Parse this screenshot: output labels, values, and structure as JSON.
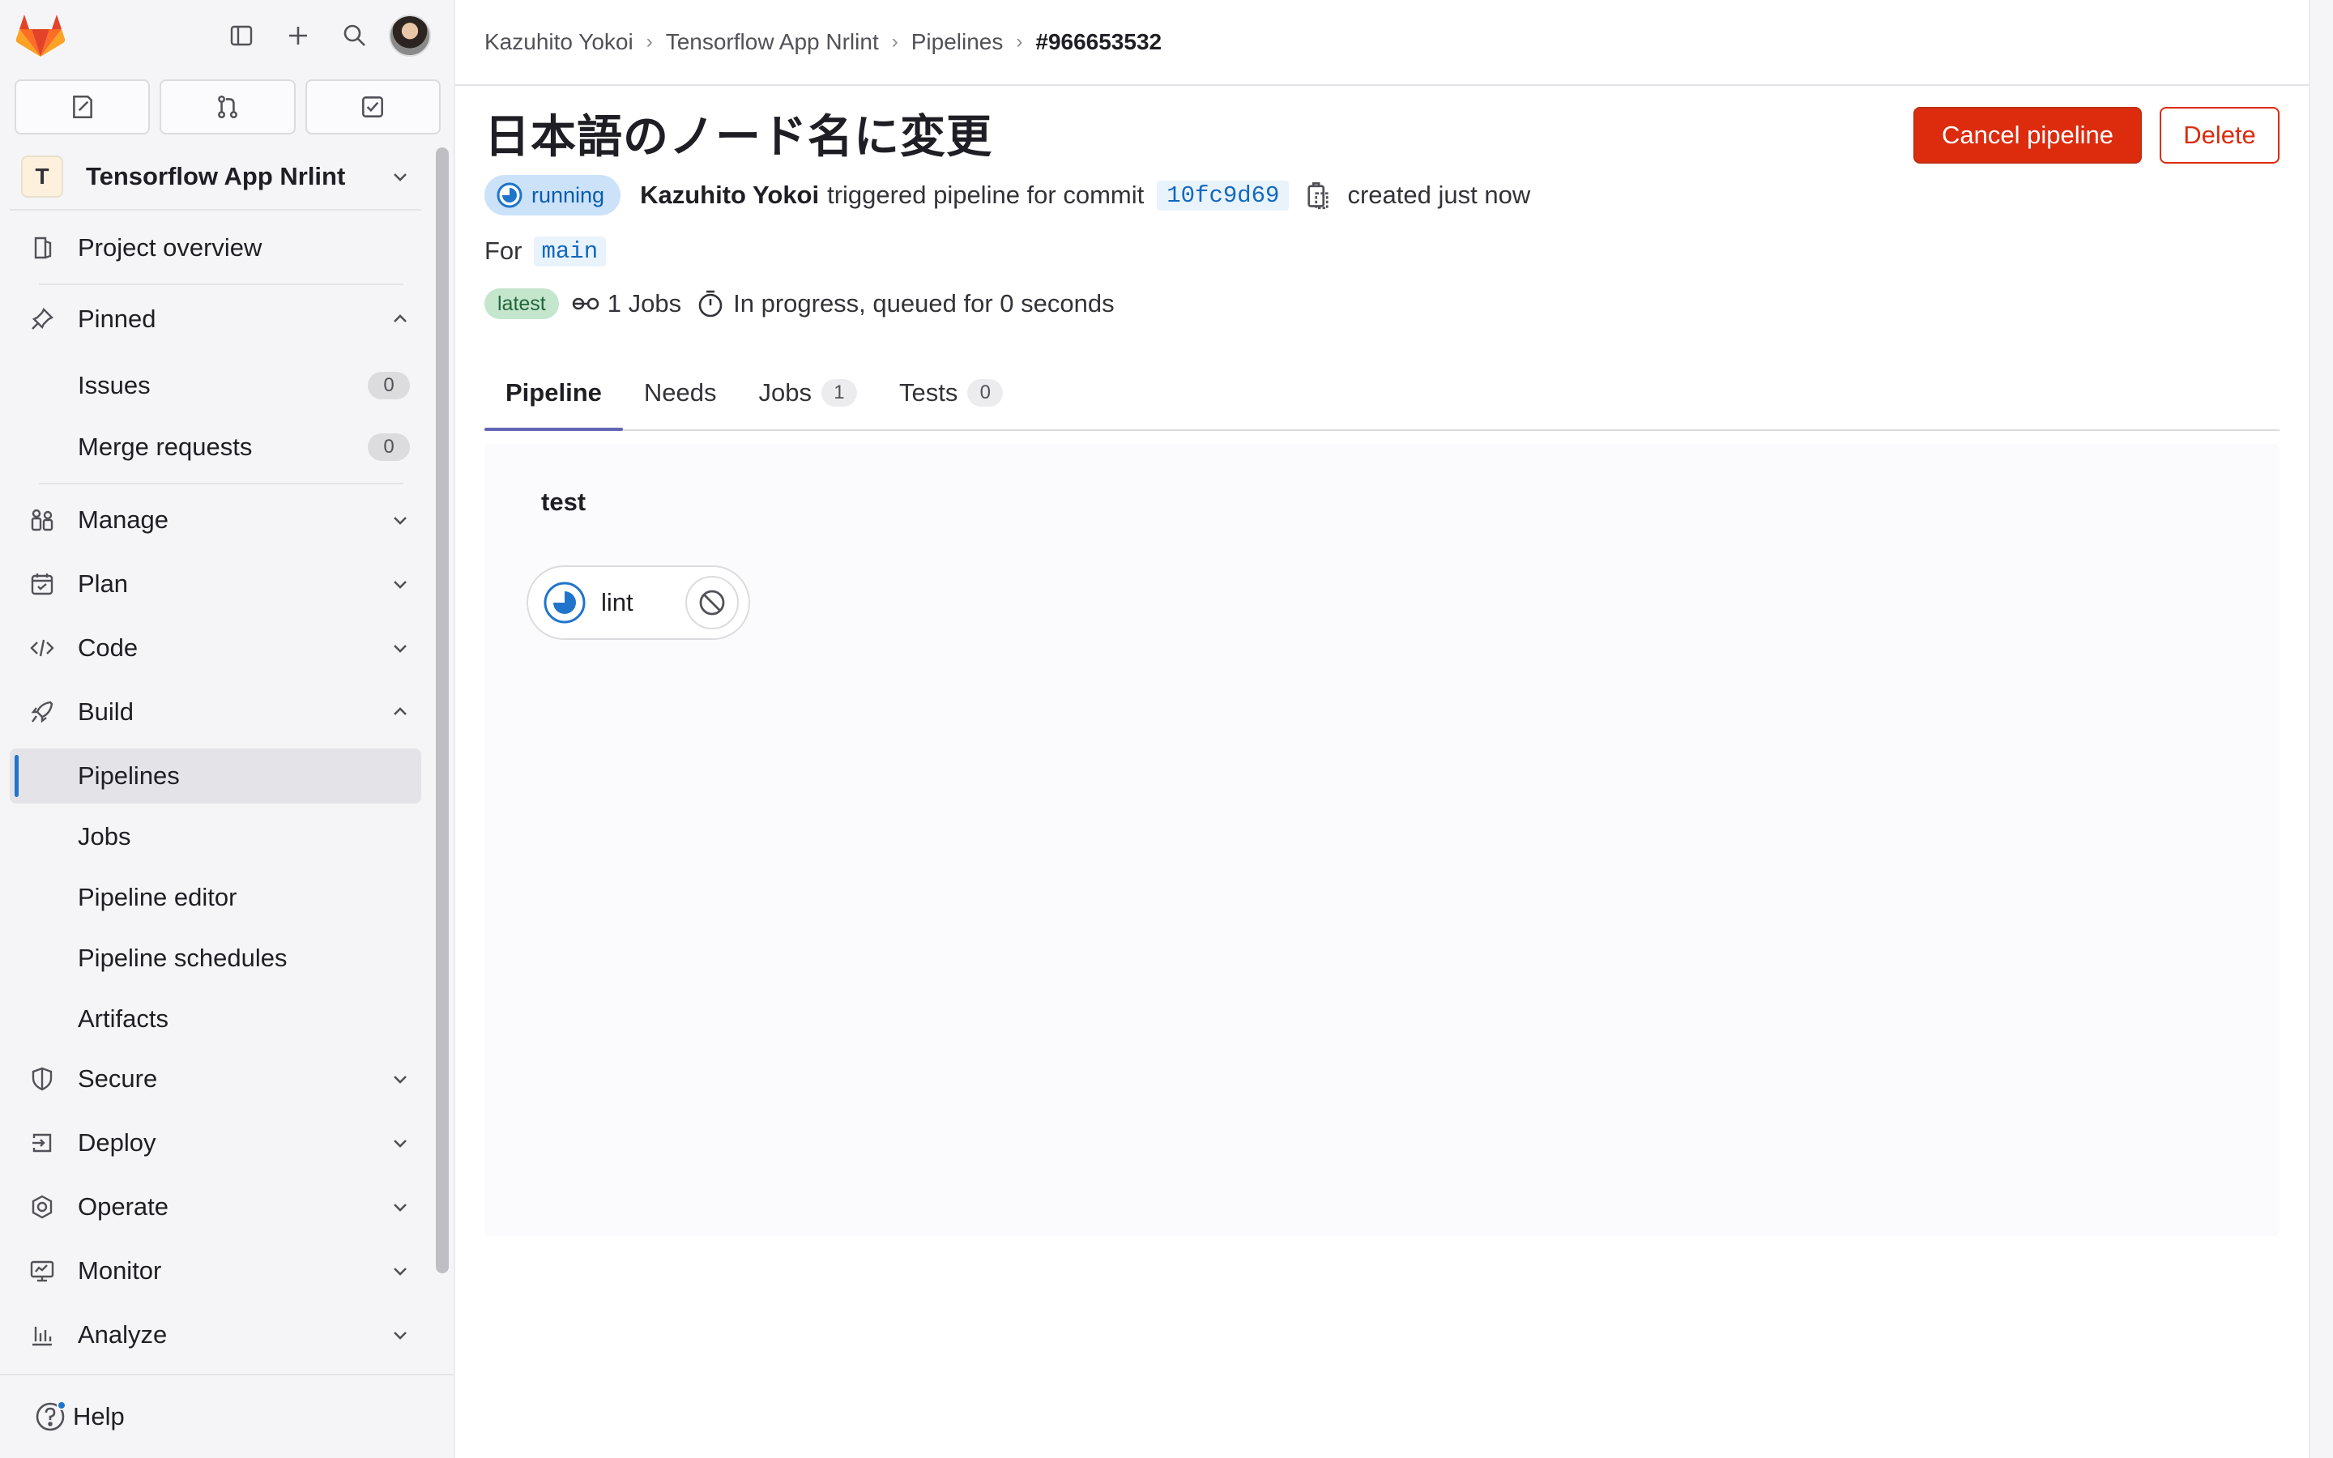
{
  "sidebar": {
    "project": {
      "avatar_letter": "T",
      "name": "Tensorflow App Nrlint"
    },
    "project_overview": "Project overview",
    "pinned": {
      "label": "Pinned",
      "items": [
        {
          "label": "Issues",
          "count": "0"
        },
        {
          "label": "Merge requests",
          "count": "0"
        }
      ]
    },
    "sections": {
      "manage": "Manage",
      "plan": "Plan",
      "code": "Code",
      "build": "Build",
      "secure": "Secure",
      "deploy": "Deploy",
      "operate": "Operate",
      "monitor": "Monitor",
      "analyze": "Analyze"
    },
    "build_items": [
      "Pipelines",
      "Jobs",
      "Pipeline editor",
      "Pipeline schedules",
      "Artifacts"
    ],
    "help": "Help"
  },
  "breadcrumb": {
    "items": [
      "Kazuhito Yokoi",
      "Tensorflow App Nrlint",
      "Pipelines"
    ],
    "current": "#966653532",
    "separator": "›"
  },
  "pipeline": {
    "title": "日本語のノード名に変更",
    "status": "running",
    "user": "Kazuhito Yokoi",
    "triggered_text": "triggered pipeline for commit",
    "commit_sha": "10fc9d69",
    "created_text": "created just now",
    "for_label": "For",
    "ref": "main",
    "latest_badge": "latest",
    "jobs_text": "1 Jobs",
    "progress_text": "In progress, queued for 0 seconds"
  },
  "actions": {
    "cancel": "Cancel pipeline",
    "delete": "Delete"
  },
  "tabs": [
    {
      "label": "Pipeline",
      "count": null
    },
    {
      "label": "Needs",
      "count": null
    },
    {
      "label": "Jobs",
      "count": "1"
    },
    {
      "label": "Tests",
      "count": "0"
    }
  ],
  "graph": {
    "stage": "test",
    "job": {
      "name": "lint",
      "status": "running"
    }
  },
  "colors": {
    "accent": "#1f75cb",
    "danger": "#dd2b0e",
    "tab_active": "#6366b4",
    "running_bg": "#cbe2f9",
    "latest_bg": "#c3e6cd"
  },
  "icons": [
    "gitlab-logo",
    "sidebar-toggle-icon",
    "plus-icon",
    "search-icon",
    "issues-icon",
    "merge-request-icon",
    "todo-icon",
    "chevron-down-icon",
    "chevron-up-icon",
    "overview-icon",
    "pin-icon",
    "manage-icon",
    "plan-icon",
    "code-icon",
    "build-icon",
    "shield-icon",
    "deploy-icon",
    "operate-icon",
    "monitor-icon",
    "analyze-icon",
    "help-icon",
    "running-icon",
    "copy-icon",
    "jobs-icon",
    "timer-icon",
    "cancel-icon"
  ]
}
